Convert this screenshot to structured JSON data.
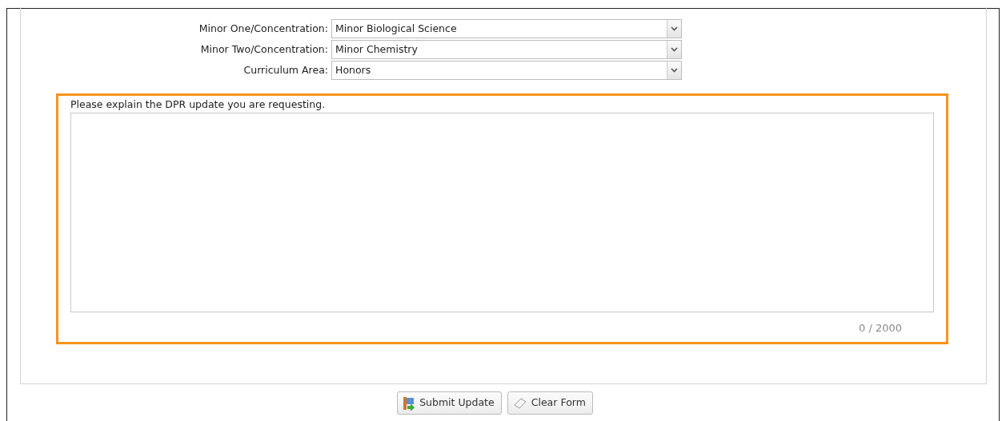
{
  "fields": [
    {
      "label": "Minor One/Concentration:",
      "value": "Minor Biological Science"
    },
    {
      "label": "Minor Two/Concentration:",
      "value": "Minor Chemistry"
    },
    {
      "label": "Curriculum Area:",
      "value": "Honors"
    }
  ],
  "request": {
    "label": "Please explain the DPR update you are requesting.",
    "counter": "0 / 2000"
  },
  "buttons": [
    {
      "label": "Submit Update",
      "kind": "submit"
    },
    {
      "label": "Clear Form",
      "kind": "clear"
    }
  ]
}
